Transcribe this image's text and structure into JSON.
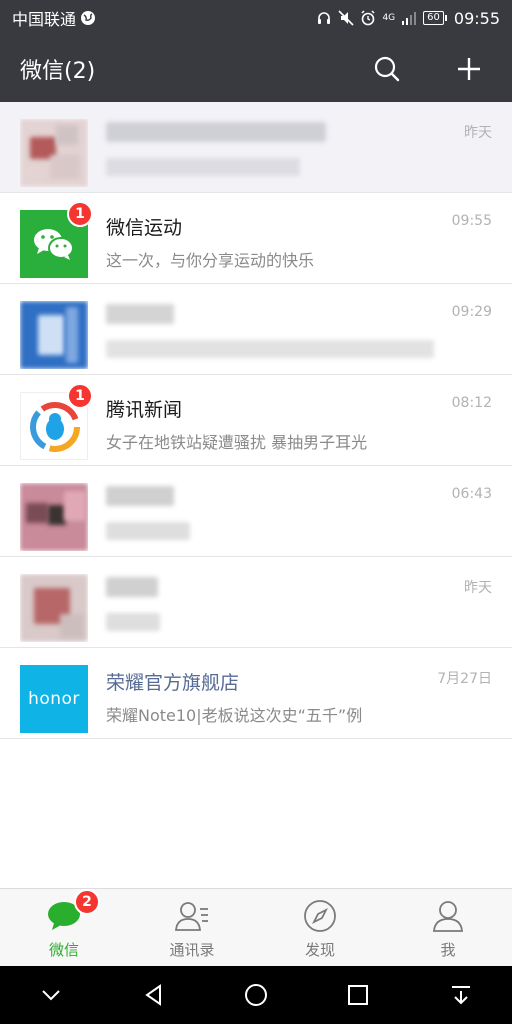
{
  "status_bar": {
    "carrier": "中国联通",
    "network": "4G",
    "battery": "60",
    "time": "09:55",
    "icons": [
      "globe-icon",
      "headset-icon",
      "mute-icon",
      "alarm-icon",
      "signal-icon",
      "battery-icon"
    ]
  },
  "header": {
    "title": "微信(2)",
    "actions": [
      "search-icon",
      "plus-icon"
    ]
  },
  "chats": [
    {
      "name": "",
      "preview": "",
      "time": "昨天",
      "pinned": true,
      "blurred": true
    },
    {
      "name": "微信运动",
      "preview": "这一次，与你分享运动的快乐",
      "time": "09:55",
      "badge": "1",
      "avatar": "wechat-sport-avatar"
    },
    {
      "name": "",
      "preview": "",
      "time": "09:29",
      "blurred": true
    },
    {
      "name": "腾讯新闻",
      "preview": "女子在地铁站疑遭骚扰 暴抽男子耳光",
      "time": "08:12",
      "badge": "1",
      "avatar": "tencent-news-avatar"
    },
    {
      "name": "",
      "preview": "",
      "time": "06:43",
      "blurred": true
    },
    {
      "name": "",
      "preview": "",
      "time": "昨天",
      "blurred": true
    },
    {
      "name": "荣耀官方旗舰店",
      "preview": "荣耀Note10|老板说这次史“五千”例",
      "time": "7月27日",
      "avatar_text": "honor"
    }
  ],
  "tabs": [
    {
      "label": "微信",
      "icon": "chat-bubble-icon",
      "active": true,
      "badge": "2"
    },
    {
      "label": "通讯录",
      "icon": "contacts-icon",
      "active": false
    },
    {
      "label": "发现",
      "icon": "compass-icon",
      "active": false
    },
    {
      "label": "我",
      "icon": "person-icon",
      "active": false
    }
  ],
  "nav": [
    "collapse-icon",
    "back-icon",
    "home-icon",
    "recents-icon",
    "notification-pull-icon"
  ],
  "colors": {
    "header_bg": "#393a3f",
    "accent_green": "#2aae2d",
    "badge_red": "#f43530",
    "link_blue": "#576b95",
    "honor_blue": "#0fb3e6"
  }
}
